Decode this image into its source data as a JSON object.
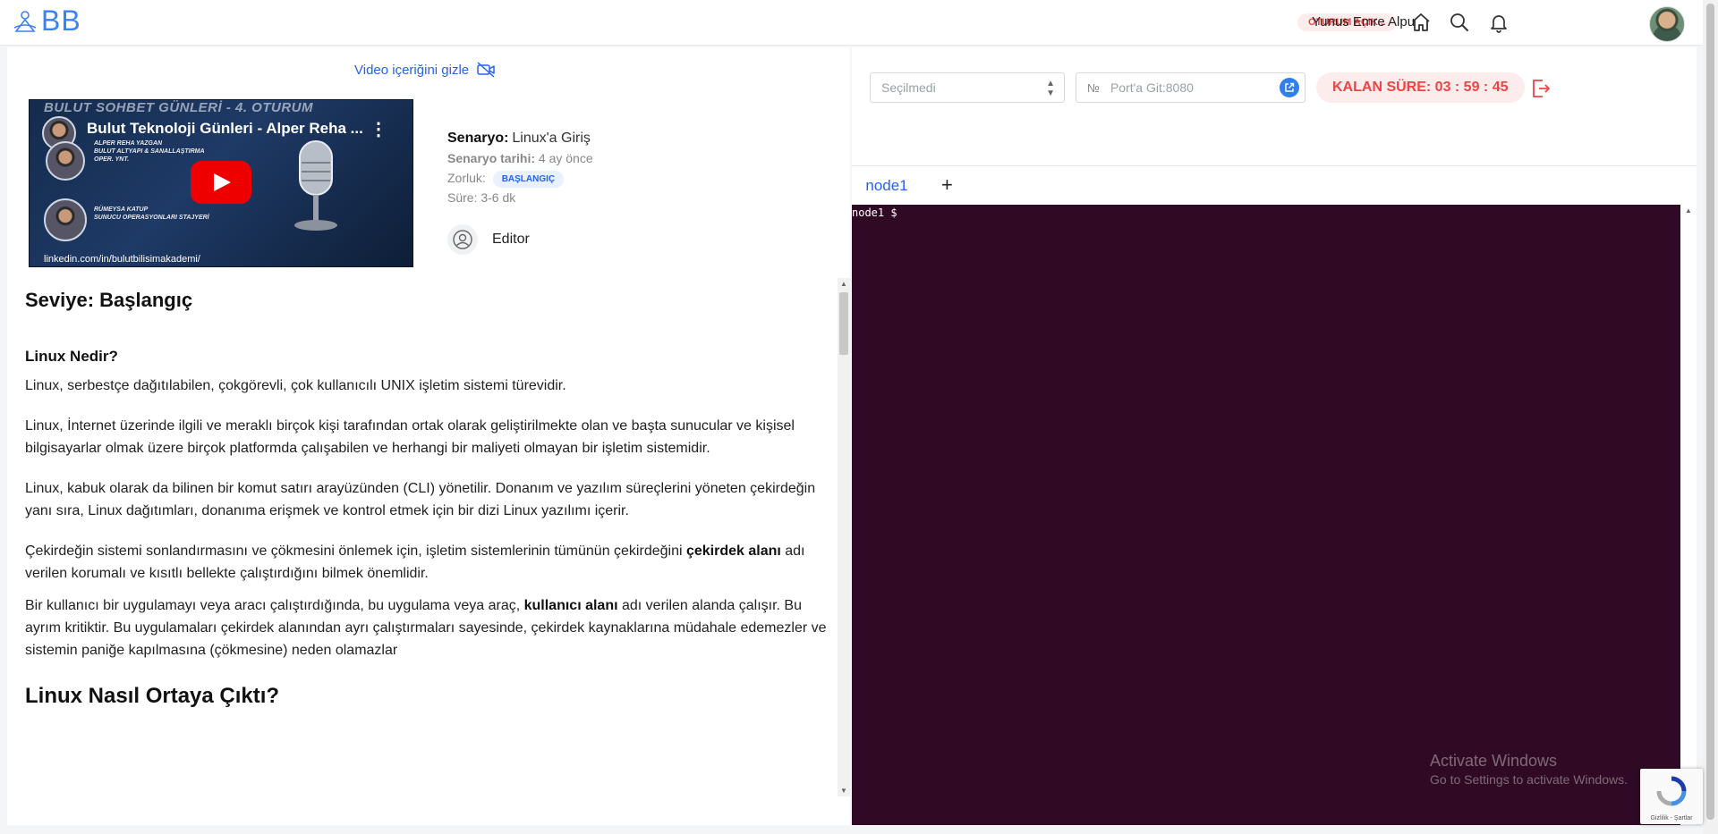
{
  "header": {
    "logo_text": "BB",
    "session_badge": "OTURUM AÇIK...",
    "icons": [
      "home-icon",
      "search-icon",
      "bell-icon"
    ],
    "user_name": "Yunus Emre Alpu"
  },
  "video": {
    "toggle_label": "Video içeriğini gizle",
    "banner_text": "BULUT SOHBET GÜNLERİ - 4. OTURUM",
    "title": "Bulut Teknoloji Günleri - Alper Reha ...",
    "speaker1": "ALPER REHA YAZGAN\nBULUT ALTYAPI & SANALLAŞTIRMA\nOPER. YNT.",
    "speaker2": "RÜMEYSA KATUP\nSUNUCU OPERASYONLARI STAJYERİ",
    "link": "linkedin.com/in/bulutbilisimakademi/"
  },
  "scenario": {
    "name_label": "Senaryo:",
    "name": "Linux'a Giriş",
    "date_label": "Senaryo tarihi:",
    "date": "4 ay önce",
    "difficulty_label": "Zorluk:",
    "difficulty": "BAŞLANGIÇ",
    "duration_label": "Süre:",
    "duration": "3-6 dk",
    "editor_label": "Editor"
  },
  "content": {
    "level_heading": "Seviye: Başlangıç",
    "section1_heading": "Linux Nedir?",
    "p1": "Linux, serbestçe dağıtılabilen, çokgörevli, çok kullanıcılı UNIX işletim sistemi türevidir.",
    "p2": "Linux, İnternet üzerinde ilgili ve meraklı birçok kişi tarafından ortak olarak geliştirilmekte olan ve başta sunucular ve kişisel bilgisayarlar olmak üzere birçok platformda çalışabilen ve herhangi bir maliyeti olmayan bir işletim sistemidir.",
    "p3": "Linux, kabuk olarak da bilinen bir komut satırı arayüzünden (CLI) yönetilir. Donanım ve yazılım süreçlerini yöneten çekirdeğin yanı sıra, Linux dağıtımları, donanıma erişmek ve kontrol etmek için bir dizi Linux yazılımı içerir.",
    "p4_a": "Çekirdeğin sistemi sonlandırmasını ve çökmesini önlemek için, işletim sistemlerinin tümünün çekirdeğini ",
    "p4_bold": "çekirdek alanı",
    "p4_b": " adı verilen korumalı ve kısıtlı bellekte çalıştırdığını bilmek önemlidir.",
    "p5_a": "Bir kullanıcı bir uygulamayı veya aracı çalıştırdığında, bu uygulama veya araç, ",
    "p5_bold": "kullanıcı alanı",
    "p5_b": " adı verilen alanda çalışır. Bu ayrım kritiktir. Bu uygulamaları çekirdek alanından ayrı çalıştırmaları sayesinde, çekirdek kaynaklarına müdahale edemezler ve sistemin paniğe kapılmasına (çökmesine) neden olamazlar",
    "section2_heading": "Linux Nasıl Ortaya Çıktı?"
  },
  "controls": {
    "select_value": "Seçilmedi",
    "port_prefix": "№",
    "port_placeholder": "Port'a Git:8080",
    "timer": "KALAN SÜRE: 03 : 59 : 45"
  },
  "terminal": {
    "tab_label": "node1",
    "add_tab": "+",
    "prompt": "node1 $"
  },
  "watermark": {
    "line1": "Activate Windows",
    "line2": "Go to Settings to activate Windows."
  },
  "recaptcha": {
    "text": "Gizlilik - Şartlar"
  },
  "colors": {
    "accent": "#2563eb",
    "danger": "#ef4444",
    "terminal_bg": "#300a24"
  }
}
